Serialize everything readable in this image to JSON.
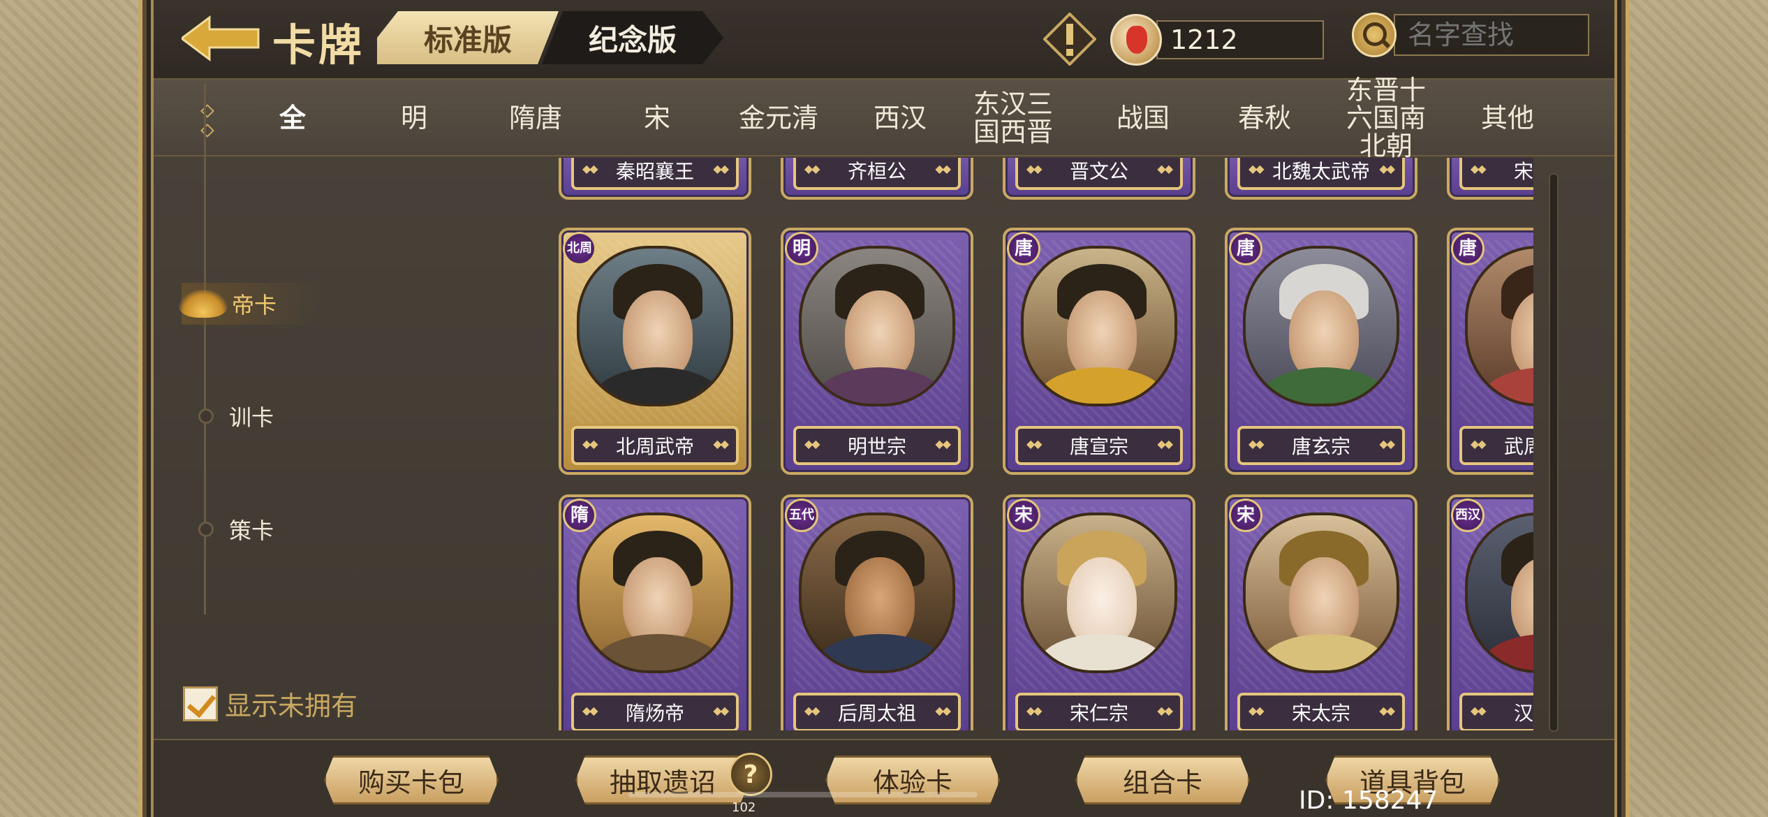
{
  "header": {
    "title": "卡牌",
    "version_tabs": [
      {
        "label": "标准版",
        "active": true
      },
      {
        "label": "纪念版",
        "active": false
      }
    ],
    "currency": {
      "amount": "1212",
      "icon": "phoenix-feather-icon"
    },
    "search": {
      "placeholder": "名字查找"
    }
  },
  "dynasty_tabs": [
    {
      "label": "全",
      "active": true
    },
    {
      "label": "明"
    },
    {
      "label": "隋唐"
    },
    {
      "label": "宋"
    },
    {
      "label": "金元清"
    },
    {
      "label": "西汉"
    },
    {
      "label": "东汉三国西晋"
    },
    {
      "label": "战国"
    },
    {
      "label": "春秋"
    },
    {
      "label": "东晋十六国南北朝"
    },
    {
      "label": "其他"
    }
  ],
  "categories": [
    {
      "label": "帝卡",
      "active": true
    },
    {
      "label": "训卡"
    },
    {
      "label": "策卡"
    }
  ],
  "show_unowned": {
    "label": "显示未拥有",
    "checked": true
  },
  "cards": {
    "partial_row": [
      {
        "name": "秦昭襄王"
      },
      {
        "name": "齐桓公"
      },
      {
        "name": "晋文公"
      },
      {
        "name": "北魏太武帝"
      },
      {
        "name": "宋武帝"
      }
    ],
    "row1": [
      {
        "name": "北周武帝",
        "dynasty": "北周"
      },
      {
        "name": "明世宗",
        "dynasty": "明"
      },
      {
        "name": "唐宣宗",
        "dynasty": "唐"
      },
      {
        "name": "唐玄宗",
        "dynasty": "唐"
      },
      {
        "name": "武周女帝",
        "dynasty": "唐"
      }
    ],
    "row2": [
      {
        "name": "隋炀帝",
        "dynasty": "隋"
      },
      {
        "name": "后周太祖",
        "dynasty": "五代"
      },
      {
        "name": "宋仁宗",
        "dynasty": "宋"
      },
      {
        "name": "宋太宗",
        "dynasty": "宋"
      },
      {
        "name": "汉宣帝",
        "dynasty": "西汉"
      }
    ]
  },
  "bottom_buttons": [
    {
      "label": "购买卡包"
    },
    {
      "label": "抽取遗诏"
    },
    {
      "label": "体验卡"
    },
    {
      "label": "组合卡"
    },
    {
      "label": "道具背包"
    }
  ],
  "edict_badge": {
    "glyph": "?",
    "count": "102"
  },
  "player_id": "ID: 158247",
  "colors": {
    "accent_gold": "#c9a862",
    "card_purple": "#6a4d9e",
    "card_gold": "#d4b06a"
  }
}
